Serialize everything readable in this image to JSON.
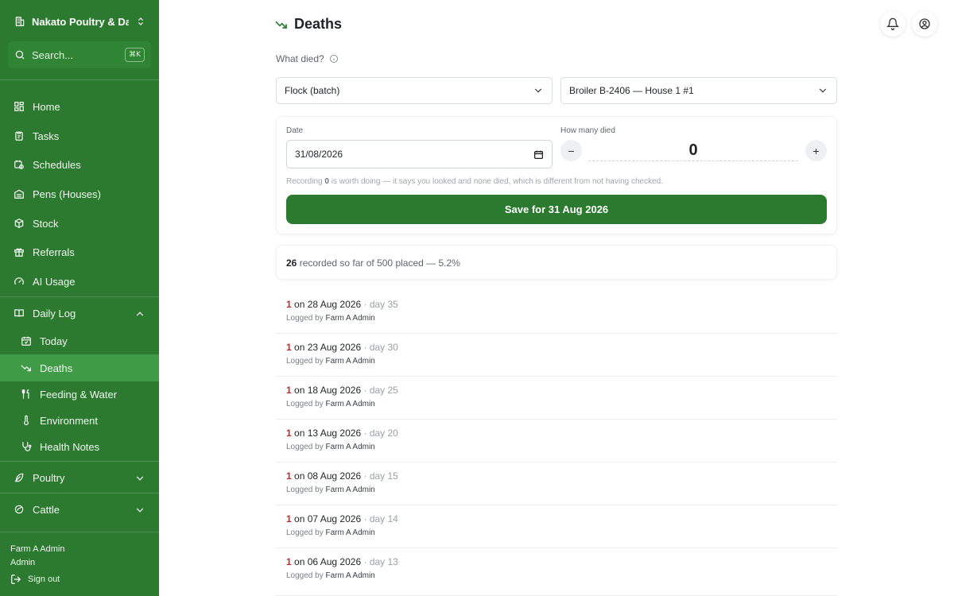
{
  "sidebar": {
    "org_name": "Nakato Poultry & Da...",
    "search_placeholder": "Search...",
    "search_shortcut": "⌘K",
    "items": [
      {
        "label": "Home"
      },
      {
        "label": "Tasks"
      },
      {
        "label": "Schedules"
      },
      {
        "label": "Pens (Houses)"
      },
      {
        "label": "Stock"
      },
      {
        "label": "Referrals"
      },
      {
        "label": "AI Usage"
      },
      {
        "label": "Daily Log"
      },
      {
        "label": "Today"
      },
      {
        "label": "Deaths"
      },
      {
        "label": "Feeding & Water"
      },
      {
        "label": "Environment"
      },
      {
        "label": "Health Notes"
      },
      {
        "label": "Poultry"
      },
      {
        "label": "Cattle"
      }
    ],
    "user_name": "Farm A Admin",
    "user_role": "Admin",
    "sign_out": "Sign out"
  },
  "page": {
    "title": "Deaths",
    "what_died_label": "What died?",
    "type_select": "Flock (batch)",
    "batch_select": "Broiler B-2406 — House 1 #1"
  },
  "form": {
    "date_label": "Date",
    "date_value": "31/08/2026",
    "count_label": "How many died",
    "count_value": "0",
    "minus": "−",
    "plus": "+",
    "hint_prefix": "Recording",
    "hint_zero": "0",
    "hint_suffix": "is worth doing — it says you looked and none died, which is different from not having checked.",
    "save_button": "Save for 31 Aug 2026"
  },
  "summary": {
    "count": "26",
    "text": "recorded so far of 500 placed — 5.2%"
  },
  "log": {
    "logged_by_prefix": "Logged by",
    "entries": [
      {
        "num": "1",
        "date": "on 28 Aug 2026",
        "day": "day 35",
        "who": "Farm A Admin"
      },
      {
        "num": "1",
        "date": "on 23 Aug 2026",
        "day": "day 30",
        "who": "Farm A Admin"
      },
      {
        "num": "1",
        "date": "on 18 Aug 2026",
        "day": "day 25",
        "who": "Farm A Admin"
      },
      {
        "num": "1",
        "date": "on 13 Aug 2026",
        "day": "day 20",
        "who": "Farm A Admin"
      },
      {
        "num": "1",
        "date": "on 08 Aug 2026",
        "day": "day 15",
        "who": "Farm A Admin"
      },
      {
        "num": "1",
        "date": "on 07 Aug 2026",
        "day": "day 14",
        "who": "Farm A Admin"
      },
      {
        "num": "1",
        "date": "on 06 Aug 2026",
        "day": "day 13",
        "who": "Farm A Admin"
      }
    ]
  },
  "colors": {
    "sidebar_bg": "#2b7a2f",
    "active_bg": "#3f9b45",
    "accent": "#2b7a2f",
    "death_count": "#c62828"
  },
  "icons": [
    "building-icon",
    "chevrons-updown-icon",
    "search-icon",
    "home-icon",
    "clipboard-icon",
    "calendar-clock-icon",
    "warehouse-icon",
    "box-icon",
    "gift-icon",
    "gauge-icon",
    "book-icon",
    "chevron-up-icon",
    "calendar-check-icon",
    "trend-down-icon",
    "utensils-icon",
    "thermometer-icon",
    "stethoscope-icon",
    "feather-icon",
    "chevron-down-icon",
    "leaf-icon",
    "logout-icon",
    "bell-icon",
    "user-circle-icon",
    "info-icon",
    "calendar-icon"
  ]
}
